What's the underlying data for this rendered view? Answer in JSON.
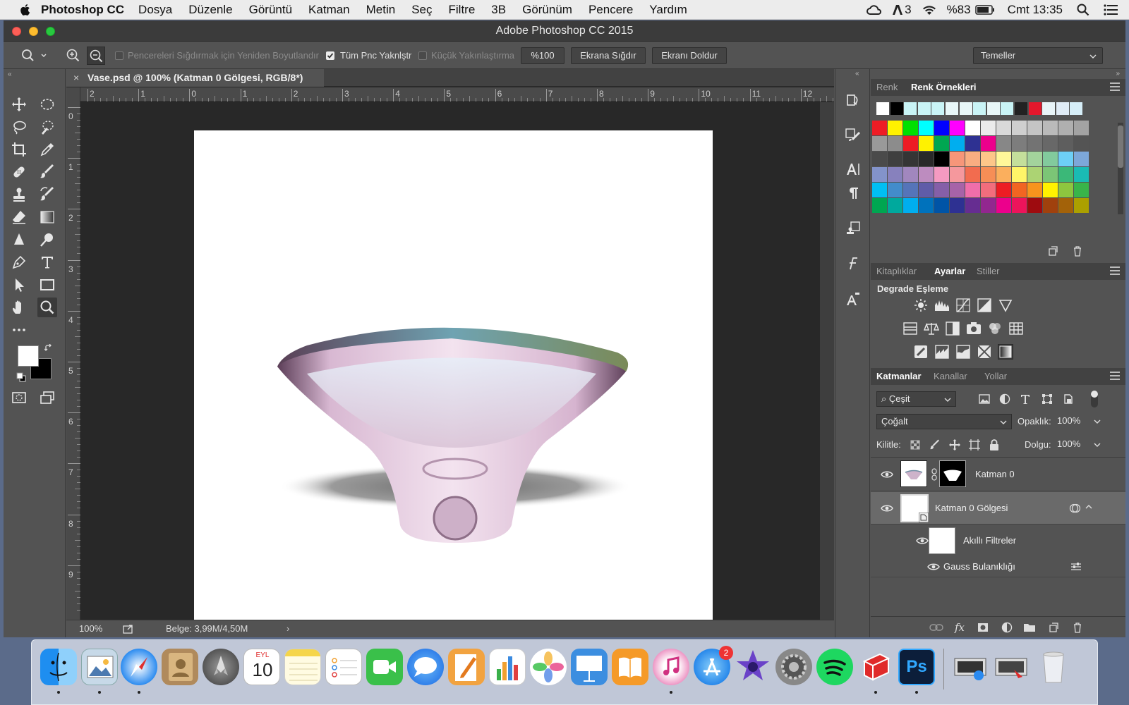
{
  "menubar": {
    "app_name": "Photoshop CC",
    "items": [
      "Dosya",
      "Düzenle",
      "Görüntü",
      "Katman",
      "Metin",
      "Seç",
      "Filtre",
      "3B",
      "Görünüm",
      "Pencere",
      "Yardım"
    ],
    "status": {
      "adobe_count": "3",
      "battery": "%83",
      "clock": "Cmt 13:35"
    }
  },
  "window": {
    "title": "Adobe Photoshop CC 2015"
  },
  "options": {
    "resize_windows_label": "Pencereleri Sığdırmak için Yeniden Boyutlandır",
    "zoom_all_label": "Tüm Pnc Yaknlştr",
    "scrubby_zoom_label": "Küçük Yakınlaştırma",
    "zoom_value": "%100",
    "fit_screen_label": "Ekrana Sığdır",
    "fill_screen_label": "Ekranı Doldur",
    "workspace": "Temeller"
  },
  "document": {
    "tab_title": "Vase.psd @ 100% (Katman 0 Gölgesi, RGB/8*)",
    "ruler_h": [
      "2",
      "1",
      "0",
      "1",
      "2",
      "3",
      "4",
      "5",
      "6",
      "7",
      "8",
      "9",
      "10",
      "11",
      "12"
    ],
    "ruler_v": [
      "0",
      "1",
      "2",
      "3",
      "4",
      "5",
      "6",
      "7",
      "8",
      "9"
    ],
    "zoom": "100%",
    "doc_size": "Belge: 3,99M/4,50M"
  },
  "color_panel": {
    "tabs": [
      "Renk",
      "Renk Örnekleri"
    ],
    "active_tab": "Renk Örnekleri",
    "recent_swatches": [
      "#ffffff",
      "#000000",
      "#c9f4f6",
      "#c9f4f6",
      "#c9f4f6",
      "#e8f7f8",
      "#e8f7f8",
      "#c9f4f6",
      "#e8f7f8",
      "#c9f4f6",
      "#222222",
      "#e3182c",
      "#e8f4f8",
      "#e0ecf6",
      "#d6eef8"
    ],
    "swatch_rows": [
      [
        "#ee1c25",
        "#fff200",
        "#00e000",
        "#00ffff",
        "#0000ff",
        "#ff00ff",
        "#ffffff",
        "#ebebeb",
        "#d9d9d9",
        "#cfcfcf",
        "#c4c4c4",
        "#bababa",
        "#afafaf",
        "#a3a3a3"
      ],
      [
        "#999999",
        "#8c8c8c",
        "#ed1c24",
        "#fff200",
        "#00a651",
        "#00aeef",
        "#2e3192",
        "#ec008c",
        "#878787",
        "#7d7d7d",
        "#737373",
        "#686868",
        "#5e5e5e",
        "#545454"
      ],
      [
        "#4a4a4a",
        "#3f3f3f",
        "#353535",
        "#292929",
        "#000000",
        "#f69679",
        "#f9ad81",
        "#fdc689",
        "#fff799",
        "#c4df9b",
        "#a3d39c",
        "#82ca9d",
        "#6dcff6",
        "#7da7d9"
      ],
      [
        "#8393ca",
        "#8781bd",
        "#a187be",
        "#bd8cbf",
        "#f49ac1",
        "#f5989d",
        "#f26c4f",
        "#f68e56",
        "#fbaf5d",
        "#fff568",
        "#acd373",
        "#7cc576",
        "#3bb878",
        "#1abbb4"
      ],
      [
        "#00bff3",
        "#438ccb",
        "#5574b9",
        "#605ca8",
        "#855fa8",
        "#a763a8",
        "#f06eaa",
        "#f26d7d",
        "#ed1c24",
        "#f26522",
        "#f7941d",
        "#fff200",
        "#8dc63f",
        "#39b54a"
      ],
      [
        "#00a651",
        "#00a99d",
        "#00aeef",
        "#0072bc",
        "#0054a6",
        "#2e3192",
        "#662d91",
        "#92278f",
        "#ec008c",
        "#ed145b",
        "#9e0b0f",
        "#a0410d",
        "#a36209",
        "#aba000"
      ]
    ]
  },
  "adjust_panel": {
    "tabs": [
      "Kitaplıklar",
      "Ayarlar",
      "Stiller"
    ],
    "active_tab": "Ayarlar",
    "hover_label": "Degrade Eşleme"
  },
  "layers_panel": {
    "tabs": [
      "Katmanlar",
      "Kanallar",
      "Yollar"
    ],
    "active_tab": "Katmanlar",
    "filter_kind": "Çeşit",
    "blend_mode": "Çoğalt",
    "opacity_label": "Opaklık:",
    "opacity_value": "100%",
    "lock_label": "Kilitle:",
    "fill_label": "Dolgu:",
    "fill_value": "100%",
    "layers": [
      {
        "name": "Katman 0"
      },
      {
        "name": "Katman 0 Gölgesi"
      },
      {
        "name": "Akıllı Filtreler"
      },
      {
        "name": "Gauss Bulanıklığı"
      }
    ]
  },
  "dock": {
    "apps": [
      "Finder",
      "Preview",
      "Safari",
      "Contacts",
      "Launchpad",
      "Calendar",
      "Notes",
      "Reminders",
      "FaceTime",
      "Messages",
      "Pages",
      "Numbers",
      "Photos",
      "Keynote",
      "iBooks",
      "iTunes",
      "App Store",
      "iMovie",
      "System Preferences",
      "Spotify",
      "SketchUp",
      "Photoshop",
      "Downloads",
      "Documents",
      "Trash"
    ],
    "calendar_month": "EYL",
    "calendar_day": "10",
    "appstore_badge": "2",
    "ps_label": "Ps"
  }
}
